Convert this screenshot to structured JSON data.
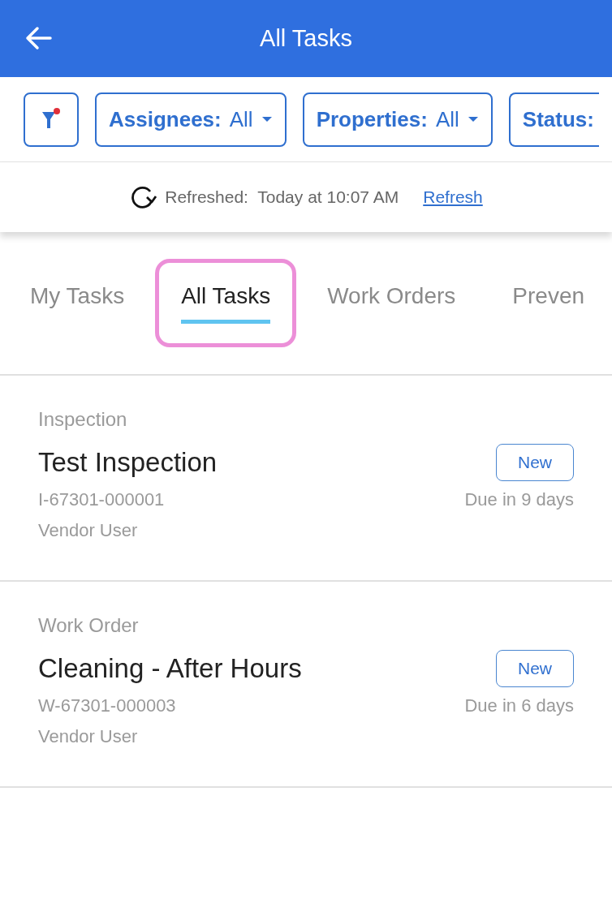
{
  "header": {
    "title": "All Tasks"
  },
  "filters": [
    {
      "label": "Assignees:",
      "value": "All"
    },
    {
      "label": "Properties:",
      "value": "All"
    },
    {
      "label": "Status:"
    }
  ],
  "filter_button": {
    "active": true
  },
  "refresh": {
    "label": "Refreshed:",
    "time": "Today at 10:07 AM",
    "link": "Refresh"
  },
  "tabs": [
    {
      "label": "My Tasks",
      "selected": false,
      "highlighted": false
    },
    {
      "label": "All Tasks",
      "selected": true,
      "highlighted": true
    },
    {
      "label": "Work Orders",
      "selected": false,
      "highlighted": false
    },
    {
      "label": "Preven",
      "selected": false,
      "highlighted": false
    }
  ],
  "tasks": [
    {
      "type": "Inspection",
      "title": "Test Inspection",
      "status": "New",
      "id": "I-67301-000001",
      "due": "Due in 9 days",
      "assignee": "Vendor User"
    },
    {
      "type": "Work Order",
      "title": "Cleaning - After Hours",
      "status": "New",
      "id": "W-67301-000003",
      "due": "Due in 6 days",
      "assignee": "Vendor User"
    }
  ]
}
